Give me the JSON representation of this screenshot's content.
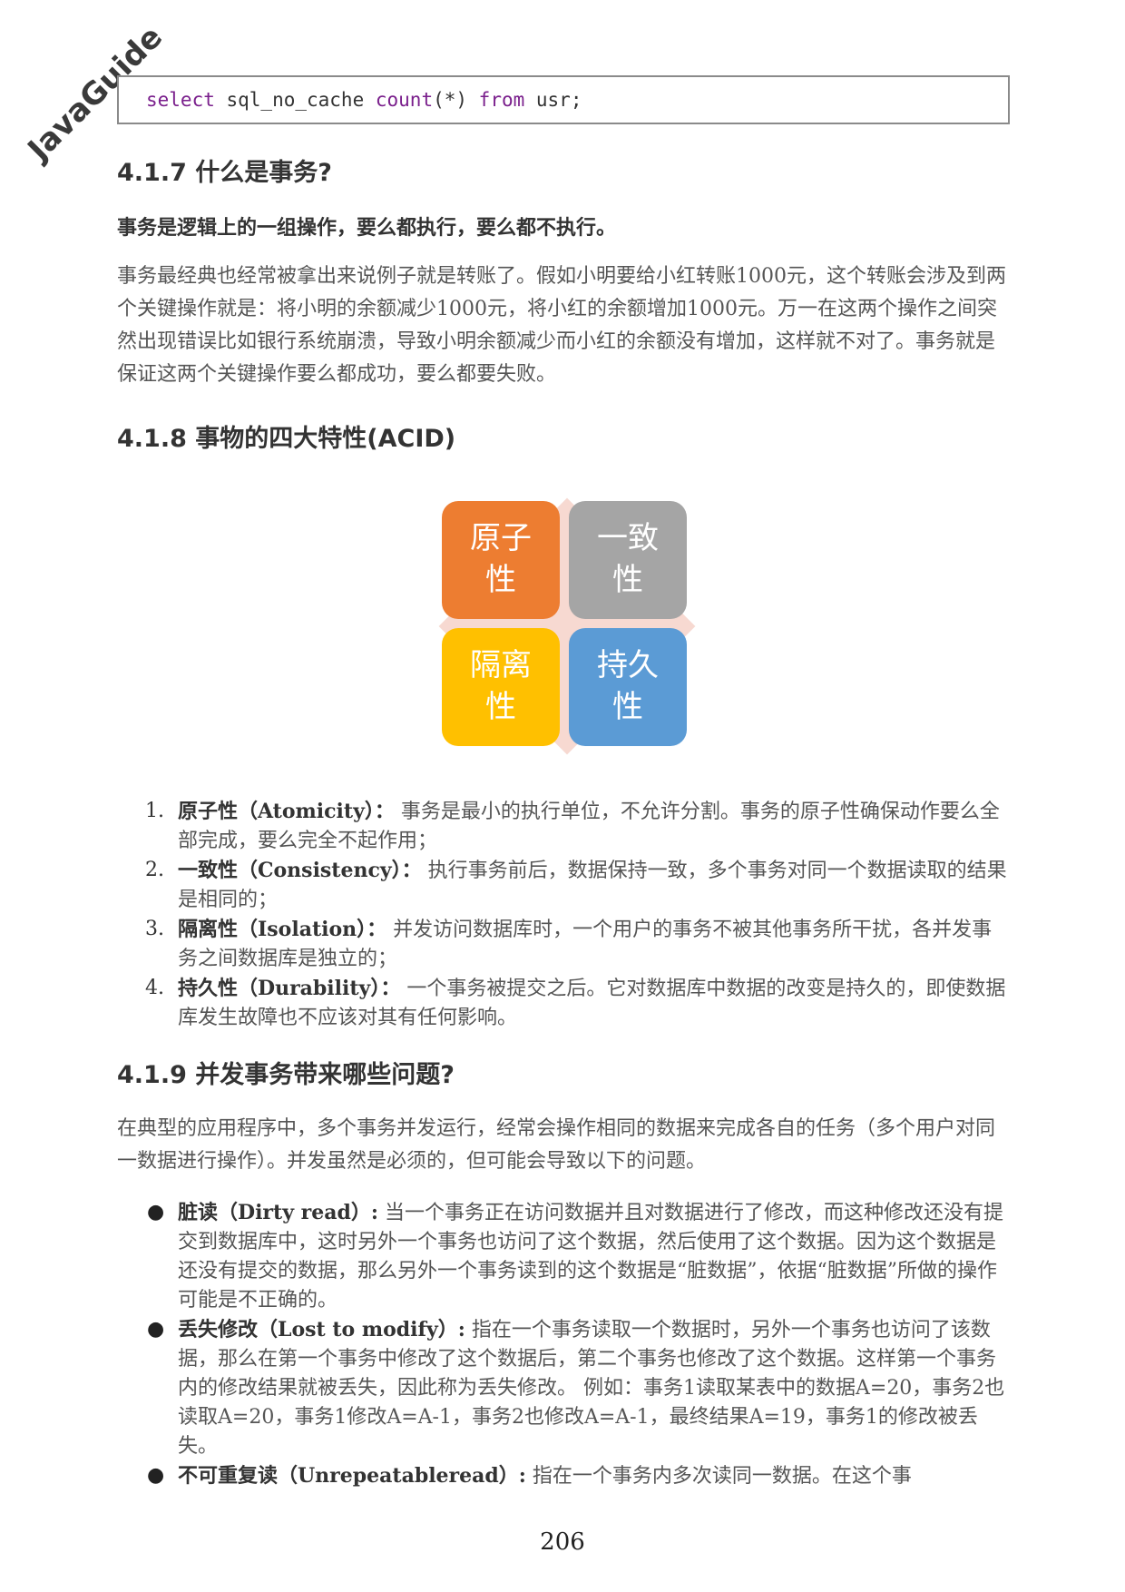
{
  "watermark": "JavaGuide",
  "code": {
    "kw1": "select",
    "t1": " sql_no_cache ",
    "kw2": "count",
    "t2": "(*) ",
    "kw3": "from",
    "t3": " usr;"
  },
  "s417": {
    "heading": "4.1.7 什么是事务?",
    "bold": "事务是逻辑上的一组操作，要么都执行，要么都不执行。",
    "para": "事务最经典也经常被拿出来说例子就是转账了。假如小明要给小红转账1000元，这个转账会涉及到两个关键操作就是：将小明的余额减少1000元，将小红的余额增加1000元。万一在这两个操作之间突然出现错误比如银行系统崩溃，导致小明余额减少而小红的余额没有增加，这样就不对了。事务就是保证这两个关键操作要么都成功，要么都要失败。"
  },
  "s418": {
    "heading": "4.1.8 事物的四大特性(ACID)",
    "diagram": {
      "atomicity": {
        "l1": "原子",
        "l2": "性"
      },
      "consistency": {
        "l1": "一致",
        "l2": "性"
      },
      "isolation": {
        "l1": "隔离",
        "l2": "性"
      },
      "durability": {
        "l1": "持久",
        "l2": "性"
      }
    },
    "items": [
      {
        "num": "1.",
        "term": "原子性（Atomicity）：",
        "text": " 事务是最小的执行单位，不允许分割。事务的原子性确保动作要么全部完成，要么完全不起作用；"
      },
      {
        "num": "2.",
        "term": "一致性（Consistency）：",
        "text": " 执行事务前后，数据保持一致，多个事务对同一个数据读取的结果是相同的；"
      },
      {
        "num": "3.",
        "term": "隔离性（Isolation）：",
        "text": " 并发访问数据库时，一个用户的事务不被其他事务所干扰，各并发事务之间数据库是独立的；"
      },
      {
        "num": "4.",
        "term": "持久性（Durability）：",
        "text": " 一个事务被提交之后。它对数据库中数据的改变是持久的，即使数据库发生故障也不应该对其有任何影响。"
      }
    ]
  },
  "s419": {
    "heading": "4.1.9 并发事务带来哪些问题?",
    "para": "在典型的应用程序中，多个事务并发运行，经常会操作相同的数据来完成各自的任务（多个用户对同一数据进行操作）。并发虽然是必须的，但可能会导致以下的问题。",
    "items": [
      {
        "term": "脏读（Dirty read）:",
        "text": " 当一个事务正在访问数据并且对数据进行了修改，而这种修改还没有提交到数据库中，这时另外一个事务也访问了这个数据，然后使用了这个数据。因为这个数据是还没有提交的数据，那么另外一个事务读到的这个数据是“脏数据”，依据“脏数据”所做的操作可能是不正确的。"
      },
      {
        "term": "丢失修改（Lost to modify）:",
        "text": " 指在一个事务读取一个数据时，另外一个事务也访问了该数据，那么在第一个事务中修改了这个数据后，第二个事务也修改了这个数据。这样第一个事务内的修改结果就被丢失，因此称为丢失修改。 例如：事务1读取某表中的数据A=20，事务2也读取A=20，事务1修改A=A-1，事务2也修改A=A-1，最终结果A=19，事务1的修改被丢失。"
      },
      {
        "term": "不可重复读（Unrepeatableread）:",
        "text": " 指在一个事务内多次读同一数据。在这个事"
      }
    ]
  },
  "page_number": "206"
}
